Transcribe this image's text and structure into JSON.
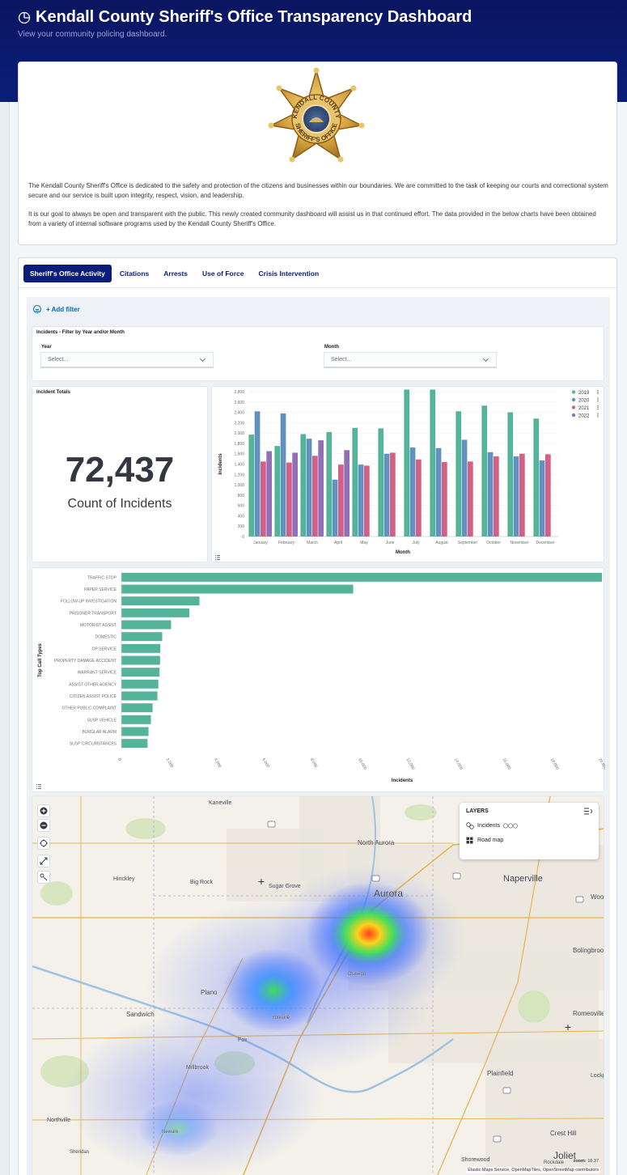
{
  "header": {
    "title": "Kendall County Sheriff's Office Transparency Dashboard",
    "subtitle": "View your community policing dashboard."
  },
  "intro": {
    "badge_text_top": "KENDALL COUNTY",
    "badge_text_bottom": "SHERIFF'S OFFICE",
    "paragraph_1": "The Kendall County Sheriff's Office is dedicated to the safety and protection of the citizens and businesses within our boundaries. We are committed to the task of keeping our courts and correctional system secure and our service is built upon integrity, respect, vision, and leadership.",
    "paragraph_2": "It is our goal to always be open and transparent with the public. This newly created community dashboard will assist us in that continued effort. The data provided in the below charts have been obtained from a variety of internal software programs used by the Kendall County Sheriff's Office."
  },
  "tabs": [
    {
      "label": "Sheriff's Office Activity",
      "active": true
    },
    {
      "label": "Citations",
      "active": false
    },
    {
      "label": "Arrests",
      "active": false
    },
    {
      "label": "Use of Force",
      "active": false
    },
    {
      "label": "Crisis Intervention",
      "active": false
    }
  ],
  "filter": {
    "add_filter_label": "+ Add filter"
  },
  "controls": {
    "title": "Incidents - Filter by Year and/or Month",
    "year_label": "Year",
    "year_placeholder": "Select...",
    "month_label": "Month",
    "month_placeholder": "Select..."
  },
  "metric": {
    "title": "Incident Totals",
    "value": "72,437",
    "label": "Count of Incidents"
  },
  "colors": {
    "2019": "#54b399",
    "2020": "#6092c0",
    "2021": "#d36086",
    "2022": "#9170b8",
    "navy": "#0b1d7a"
  },
  "chart_data": [
    {
      "type": "bar",
      "xlabel": "Month",
      "ylabel": "Incidents",
      "ylim": [
        0,
        2800
      ],
      "yticks": [
        0,
        200,
        400,
        600,
        800,
        1000,
        1200,
        1400,
        1600,
        1800,
        2000,
        2200,
        2400,
        2600,
        2800
      ],
      "ytick_labels": [
        "0",
        "200",
        "400",
        "600",
        "800",
        "1,000",
        "1,200",
        "1,400",
        "1,600",
        "1,800",
        "2,000",
        "2,200",
        "2,400",
        "2,600",
        "2,800"
      ],
      "legend_position": "top-right",
      "categories": [
        "January",
        "February",
        "March",
        "April",
        "May",
        "June",
        "July",
        "August",
        "September",
        "October",
        "November",
        "December"
      ],
      "series": [
        {
          "name": "2019",
          "values": [
            1970,
            1750,
            1980,
            2020,
            2100,
            2090,
            2840,
            2840,
            2420,
            2530,
            2400,
            2280
          ]
        },
        {
          "name": "2020",
          "values": [
            2420,
            2380,
            1890,
            1100,
            1390,
            1600,
            1720,
            1710,
            1870,
            1630,
            1550,
            1470
          ]
        },
        {
          "name": "2021",
          "values": [
            1450,
            1430,
            1560,
            1390,
            1370,
            1620,
            1490,
            1440,
            1450,
            1550,
            1600,
            1590
          ]
        },
        {
          "name": "2022",
          "values": [
            1650,
            1620,
            1860,
            1670,
            null,
            null,
            null,
            null,
            null,
            null,
            null,
            null
          ]
        }
      ]
    },
    {
      "type": "bar",
      "orientation": "horizontal",
      "xlabel": "Incidents",
      "ylabel": "Top Call Types",
      "xlim": [
        0,
        20000
      ],
      "xticks": [
        0,
        2000,
        4000,
        6000,
        8000,
        10000,
        12000,
        14000,
        16000,
        18000,
        20000
      ],
      "xtick_labels": [
        "0",
        "2,000",
        "4,000",
        "6,000",
        "8,000",
        "10,000",
        "12,000",
        "14,000",
        "16,000",
        "18,000",
        "20,000"
      ],
      "categories": [
        "TRAFFIC STOP",
        "PAPER SERVICE",
        "FOLLOW-UP INVESTIGATION",
        "PRISONER TRANSPORT",
        "MOTORIST ASSIST",
        "DOMESTIC",
        "OP SERVICE",
        "PROPERTY DAMAGE ACCIDENT",
        "WARRANT SERVICE",
        "ASSIST OTHER AGENCY",
        "CITIZEN ASSIST POLICE",
        "OTHER PUBLIC COMPLAINT",
        "SUSP VEHICLE",
        "BURGLAR ALARM",
        "SUSP CIRCUMSTANCES"
      ],
      "values": [
        20000,
        9650,
        3250,
        2830,
        2070,
        1700,
        1620,
        1610,
        1590,
        1540,
        1500,
        1300,
        1230,
        1130,
        1090
      ]
    }
  ],
  "map": {
    "layers_title": "LAYERS",
    "layer_incidents": "Incidents",
    "layer_road": "Road map",
    "attribution": "Elastic Maps Service, OpenMapTiles, OpenStreetMap contributors",
    "zoom_label": "zoom:",
    "zoom_value": "10.37",
    "places": [
      "Kaneville",
      "North Aurora",
      "Naperville",
      "Hinckley",
      "Big Rock",
      "Sugar Grove",
      "Aurora",
      "Woo",
      "Bolingbrook",
      "Oswego",
      "Plano",
      "Sandwich",
      "Yorkville",
      "Romeoville",
      "Fox",
      "Plainfield",
      "Lockpo",
      "Millbrook",
      "Northville",
      "Crest Hill",
      "Newark",
      "Sheridan",
      "Shorewood",
      "Joliet",
      "Rockdale"
    ]
  }
}
